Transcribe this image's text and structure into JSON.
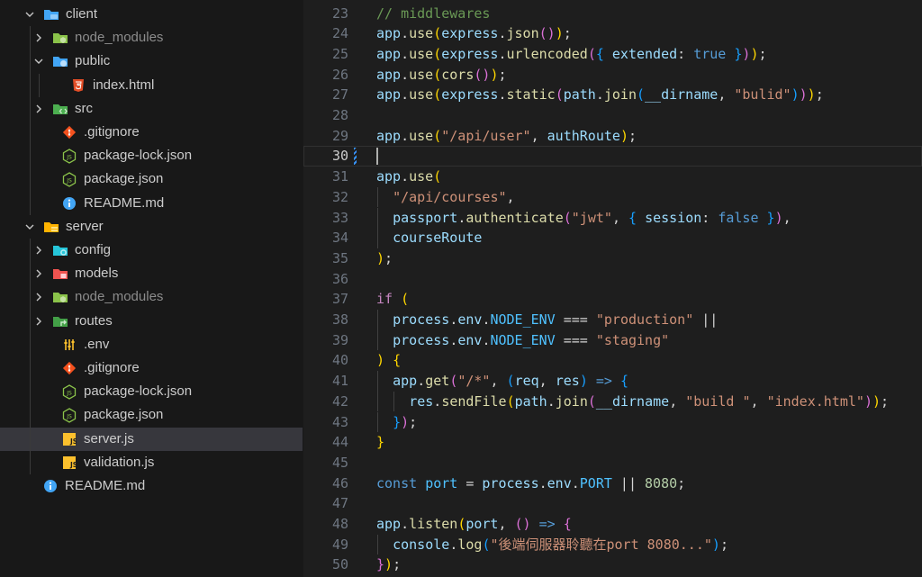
{
  "explorer": {
    "items": [
      {
        "label": "client",
        "type": "folder",
        "expanded": true,
        "depth": 0,
        "icon": "folder-client-icon",
        "dim": false
      },
      {
        "label": "node_modules",
        "type": "folder",
        "expanded": false,
        "depth": 1,
        "icon": "folder-node-icon",
        "dim": true
      },
      {
        "label": "public",
        "type": "folder",
        "expanded": true,
        "depth": 1,
        "icon": "folder-public-icon",
        "dim": false
      },
      {
        "label": "index.html",
        "type": "file",
        "depth": 2,
        "icon": "html-icon",
        "dim": false
      },
      {
        "label": "src",
        "type": "folder",
        "expanded": false,
        "depth": 1,
        "icon": "folder-src-icon",
        "dim": false
      },
      {
        "label": ".gitignore",
        "type": "file",
        "depth": 1,
        "icon": "git-icon",
        "dim": false
      },
      {
        "label": "package-lock.json",
        "type": "file",
        "depth": 1,
        "icon": "nodejs-icon",
        "dim": false
      },
      {
        "label": "package.json",
        "type": "file",
        "depth": 1,
        "icon": "nodejs-icon",
        "dim": false
      },
      {
        "label": "README.md",
        "type": "file",
        "depth": 1,
        "icon": "info-icon",
        "dim": false
      },
      {
        "label": "server",
        "type": "folder",
        "expanded": true,
        "depth": 0,
        "icon": "folder-server-icon",
        "dim": false
      },
      {
        "label": "config",
        "type": "folder",
        "expanded": false,
        "depth": 1,
        "icon": "folder-config-icon",
        "dim": false
      },
      {
        "label": "models",
        "type": "folder",
        "expanded": false,
        "depth": 1,
        "icon": "folder-models-icon",
        "dim": false
      },
      {
        "label": "node_modules",
        "type": "folder",
        "expanded": false,
        "depth": 1,
        "icon": "folder-node-icon",
        "dim": true
      },
      {
        "label": "routes",
        "type": "folder",
        "expanded": false,
        "depth": 1,
        "icon": "folder-routes-icon",
        "dim": false
      },
      {
        "label": ".env",
        "type": "file",
        "depth": 1,
        "icon": "settings-icon",
        "dim": false
      },
      {
        "label": ".gitignore",
        "type": "file",
        "depth": 1,
        "icon": "git-icon",
        "dim": false
      },
      {
        "label": "package-lock.json",
        "type": "file",
        "depth": 1,
        "icon": "nodejs-icon",
        "dim": false
      },
      {
        "label": "package.json",
        "type": "file",
        "depth": 1,
        "icon": "nodejs-icon",
        "dim": false
      },
      {
        "label": "server.js",
        "type": "file",
        "depth": 1,
        "icon": "js-icon",
        "dim": false,
        "selected": true
      },
      {
        "label": "validation.js",
        "type": "file",
        "depth": 1,
        "icon": "js-icon",
        "dim": false
      },
      {
        "label": "README.md",
        "type": "file",
        "depth": 0,
        "icon": "info-icon",
        "dim": false
      }
    ]
  },
  "editor": {
    "active_line": 30,
    "lines": [
      {
        "n": "23",
        "indent": 0,
        "tokens": [
          [
            "cm",
            "// middlewares"
          ]
        ]
      },
      {
        "n": "24",
        "indent": 0,
        "tokens": [
          [
            "id",
            "app"
          ],
          [
            "pl",
            "."
          ],
          [
            "fn",
            "use"
          ],
          [
            "p1",
            "("
          ],
          [
            "id",
            "express"
          ],
          [
            "pl",
            "."
          ],
          [
            "fn",
            "json"
          ],
          [
            "p2",
            "()"
          ],
          [
            "p1",
            ")"
          ],
          [
            "pl",
            ";"
          ]
        ]
      },
      {
        "n": "25",
        "indent": 0,
        "tokens": [
          [
            "id",
            "app"
          ],
          [
            "pl",
            "."
          ],
          [
            "fn",
            "use"
          ],
          [
            "p1",
            "("
          ],
          [
            "id",
            "express"
          ],
          [
            "pl",
            "."
          ],
          [
            "fn",
            "urlencoded"
          ],
          [
            "p2",
            "("
          ],
          [
            "p3",
            "{"
          ],
          [
            "pl",
            " "
          ],
          [
            "id",
            "extended"
          ],
          [
            "pl",
            ": "
          ],
          [
            "kw",
            "true"
          ],
          [
            "pl",
            " "
          ],
          [
            "p3",
            "}"
          ],
          [
            "p2",
            ")"
          ],
          [
            "p1",
            ")"
          ],
          [
            "pl",
            ";"
          ]
        ]
      },
      {
        "n": "26",
        "indent": 0,
        "tokens": [
          [
            "id",
            "app"
          ],
          [
            "pl",
            "."
          ],
          [
            "fn",
            "use"
          ],
          [
            "p1",
            "("
          ],
          [
            "fn",
            "cors"
          ],
          [
            "p2",
            "()"
          ],
          [
            "p1",
            ")"
          ],
          [
            "pl",
            ";"
          ]
        ]
      },
      {
        "n": "27",
        "indent": 0,
        "tokens": [
          [
            "id",
            "app"
          ],
          [
            "pl",
            "."
          ],
          [
            "fn",
            "use"
          ],
          [
            "p1",
            "("
          ],
          [
            "id",
            "express"
          ],
          [
            "pl",
            "."
          ],
          [
            "fn",
            "static"
          ],
          [
            "p2",
            "("
          ],
          [
            "id",
            "path"
          ],
          [
            "pl",
            "."
          ],
          [
            "fn",
            "join"
          ],
          [
            "p3",
            "("
          ],
          [
            "id",
            "__dirname"
          ],
          [
            "pl",
            ", "
          ],
          [
            "str",
            "\"bulid\""
          ],
          [
            "p3",
            ")"
          ],
          [
            "p2",
            ")"
          ],
          [
            "p1",
            ")"
          ],
          [
            "pl",
            ";"
          ]
        ]
      },
      {
        "n": "28",
        "indent": 0,
        "tokens": []
      },
      {
        "n": "29",
        "indent": 0,
        "tokens": [
          [
            "id",
            "app"
          ],
          [
            "pl",
            "."
          ],
          [
            "fn",
            "use"
          ],
          [
            "p1",
            "("
          ],
          [
            "str",
            "\"/api/user\""
          ],
          [
            "pl",
            ", "
          ],
          [
            "id",
            "authRoute"
          ],
          [
            "p1",
            ")"
          ],
          [
            "pl",
            ";"
          ]
        ]
      },
      {
        "n": "30",
        "indent": 0,
        "tokens": [],
        "current": true,
        "modified": true
      },
      {
        "n": "31",
        "indent": 0,
        "tokens": [
          [
            "id",
            "app"
          ],
          [
            "pl",
            "."
          ],
          [
            "fn",
            "use"
          ],
          [
            "p1",
            "("
          ]
        ]
      },
      {
        "n": "32",
        "indent": 1,
        "tokens": [
          [
            "str",
            "\"/api/courses\""
          ],
          [
            "pl",
            ","
          ]
        ]
      },
      {
        "n": "33",
        "indent": 1,
        "tokens": [
          [
            "id",
            "passport"
          ],
          [
            "pl",
            "."
          ],
          [
            "fn",
            "authenticate"
          ],
          [
            "p2",
            "("
          ],
          [
            "str",
            "\"jwt\""
          ],
          [
            "pl",
            ", "
          ],
          [
            "p3",
            "{"
          ],
          [
            "pl",
            " "
          ],
          [
            "id",
            "session"
          ],
          [
            "pl",
            ": "
          ],
          [
            "kw",
            "false"
          ],
          [
            "pl",
            " "
          ],
          [
            "p3",
            "}"
          ],
          [
            "p2",
            ")"
          ],
          [
            "pl",
            ","
          ]
        ]
      },
      {
        "n": "34",
        "indent": 1,
        "tokens": [
          [
            "id",
            "courseRoute"
          ]
        ]
      },
      {
        "n": "35",
        "indent": 0,
        "tokens": [
          [
            "p1",
            ")"
          ],
          [
            "pl",
            ";"
          ]
        ]
      },
      {
        "n": "36",
        "indent": 0,
        "tokens": []
      },
      {
        "n": "37",
        "indent": 0,
        "tokens": [
          [
            "ctl",
            "if"
          ],
          [
            "pl",
            " "
          ],
          [
            "p1",
            "("
          ]
        ]
      },
      {
        "n": "38",
        "indent": 1,
        "tokens": [
          [
            "id",
            "process"
          ],
          [
            "pl",
            "."
          ],
          [
            "id",
            "env"
          ],
          [
            "pl",
            "."
          ],
          [
            "const",
            "NODE_ENV"
          ],
          [
            "pl",
            " === "
          ],
          [
            "str",
            "\"production\""
          ],
          [
            "pl",
            " ||"
          ]
        ]
      },
      {
        "n": "39",
        "indent": 1,
        "tokens": [
          [
            "id",
            "process"
          ],
          [
            "pl",
            "."
          ],
          [
            "id",
            "env"
          ],
          [
            "pl",
            "."
          ],
          [
            "const",
            "NODE_ENV"
          ],
          [
            "pl",
            " === "
          ],
          [
            "str",
            "\"staging\""
          ]
        ]
      },
      {
        "n": "40",
        "indent": 0,
        "tokens": [
          [
            "p1",
            ")"
          ],
          [
            "pl",
            " "
          ],
          [
            "p1",
            "{"
          ]
        ]
      },
      {
        "n": "41",
        "indent": 1,
        "tokens": [
          [
            "id",
            "app"
          ],
          [
            "pl",
            "."
          ],
          [
            "fn",
            "get"
          ],
          [
            "p2",
            "("
          ],
          [
            "str",
            "\"/*\""
          ],
          [
            "pl",
            ", "
          ],
          [
            "p3",
            "("
          ],
          [
            "id",
            "req"
          ],
          [
            "pl",
            ", "
          ],
          [
            "id",
            "res"
          ],
          [
            "p3",
            ")"
          ],
          [
            "pl",
            " "
          ],
          [
            "kw",
            "=>"
          ],
          [
            "pl",
            " "
          ],
          [
            "p3",
            "{"
          ]
        ]
      },
      {
        "n": "42",
        "indent": 2,
        "tokens": [
          [
            "id",
            "res"
          ],
          [
            "pl",
            "."
          ],
          [
            "fn",
            "sendFile"
          ],
          [
            "p1",
            "("
          ],
          [
            "id",
            "path"
          ],
          [
            "pl",
            "."
          ],
          [
            "fn",
            "join"
          ],
          [
            "p2",
            "("
          ],
          [
            "id",
            "__dirname"
          ],
          [
            "pl",
            ", "
          ],
          [
            "str",
            "\"build \""
          ],
          [
            "pl",
            ", "
          ],
          [
            "str",
            "\"index.html\""
          ],
          [
            "p2",
            ")"
          ],
          [
            "p1",
            ")"
          ],
          [
            "pl",
            ";"
          ]
        ]
      },
      {
        "n": "43",
        "indent": 1,
        "tokens": [
          [
            "p3",
            "}"
          ],
          [
            "p2",
            ")"
          ],
          [
            "pl",
            ";"
          ]
        ]
      },
      {
        "n": "44",
        "indent": 0,
        "tokens": [
          [
            "p1",
            "}"
          ]
        ]
      },
      {
        "n": "45",
        "indent": 0,
        "tokens": []
      },
      {
        "n": "46",
        "indent": 0,
        "tokens": [
          [
            "kw",
            "const"
          ],
          [
            "pl",
            " "
          ],
          [
            "const",
            "port"
          ],
          [
            "pl",
            " = "
          ],
          [
            "id",
            "process"
          ],
          [
            "pl",
            "."
          ],
          [
            "id",
            "env"
          ],
          [
            "pl",
            "."
          ],
          [
            "const",
            "PORT"
          ],
          [
            "pl",
            " || "
          ],
          [
            "num",
            "8080"
          ],
          [
            "pl",
            ";"
          ]
        ]
      },
      {
        "n": "47",
        "indent": 0,
        "tokens": []
      },
      {
        "n": "48",
        "indent": 0,
        "tokens": [
          [
            "id",
            "app"
          ],
          [
            "pl",
            "."
          ],
          [
            "fn",
            "listen"
          ],
          [
            "p1",
            "("
          ],
          [
            "id",
            "port"
          ],
          [
            "pl",
            ", "
          ],
          [
            "p2",
            "()"
          ],
          [
            "pl",
            " "
          ],
          [
            "kw",
            "=>"
          ],
          [
            "pl",
            " "
          ],
          [
            "p2",
            "{"
          ]
        ]
      },
      {
        "n": "49",
        "indent": 1,
        "tokens": [
          [
            "id",
            "console"
          ],
          [
            "pl",
            "."
          ],
          [
            "fn",
            "log"
          ],
          [
            "p3",
            "("
          ],
          [
            "str",
            "\"後端伺服器聆聽在port 8080...\""
          ],
          [
            "p3",
            ")"
          ],
          [
            "pl",
            ";"
          ]
        ]
      },
      {
        "n": "50",
        "indent": 0,
        "tokens": [
          [
            "p2",
            "}"
          ],
          [
            "p1",
            ")"
          ],
          [
            "pl",
            ";"
          ]
        ]
      }
    ]
  },
  "colors": {
    "bg_editor": "#1e1e1e",
    "bg_sidebar": "#181818",
    "selection": "#37373d",
    "string": "#ce9178",
    "keyword": "#569cd6",
    "function": "#dcdcaa",
    "variable": "#9cdcfe",
    "comment": "#6a9955"
  }
}
